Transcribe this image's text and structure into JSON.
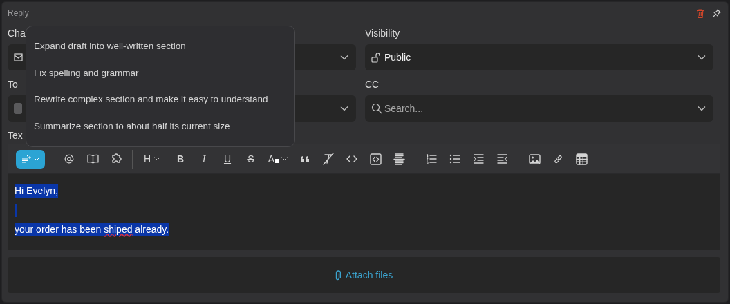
{
  "panel": {
    "title": "Reply"
  },
  "fields": [
    {
      "label": "Cha",
      "kind": "channel"
    },
    {
      "label": "Visibility",
      "kind": "select",
      "value": "Public"
    },
    {
      "label": "To",
      "kind": "recipient"
    },
    {
      "label": "CC",
      "kind": "search",
      "placeholder": "Search..."
    }
  ],
  "text_label": "Tex",
  "toolbar": [
    {
      "kind": "ai"
    },
    {
      "kind": "divider"
    },
    {
      "kind": "icon"
    },
    {
      "kind": "icon"
    },
    {
      "kind": "icon"
    },
    {
      "kind": "divider"
    },
    {
      "kind": "dropdown",
      "label": "H"
    },
    {
      "kind": "glyph",
      "label": "B"
    },
    {
      "kind": "glyph",
      "label": "I"
    },
    {
      "kind": "glyph",
      "label": "U"
    },
    {
      "kind": "glyph",
      "label": "S"
    },
    {
      "kind": "color",
      "label": "A"
    },
    {
      "kind": "icon"
    },
    {
      "kind": "icon"
    },
    {
      "kind": "icon"
    },
    {
      "kind": "icon"
    },
    {
      "kind": "icon"
    },
    {
      "kind": "divider"
    },
    {
      "kind": "icon"
    },
    {
      "kind": "icon"
    },
    {
      "kind": "icon"
    },
    {
      "kind": "icon"
    },
    {
      "kind": "divider"
    },
    {
      "kind": "icon"
    },
    {
      "kind": "icon"
    },
    {
      "kind": "icon"
    }
  ],
  "body_lines": [
    {
      "kind": "text",
      "segments": [
        {
          "text": "Hi Evelyn,",
          "misspelled": false
        }
      ]
    },
    {
      "kind": "cursor"
    },
    {
      "kind": "text",
      "segments": [
        {
          "text": "your order has been ",
          "misspelled": false
        },
        {
          "text": "shiped",
          "misspelled": true
        },
        {
          "text": " already.",
          "misspelled": false
        }
      ]
    }
  ],
  "attach": {
    "label": "Attach files"
  },
  "menu": {
    "items": [
      {
        "label": "Expand draft into well-written section"
      },
      {
        "label": "Fix spelling and grammar"
      },
      {
        "label": "Rewrite complex section and make it easy to understand"
      },
      {
        "label": "Summarize section to about half its current size"
      }
    ]
  }
}
